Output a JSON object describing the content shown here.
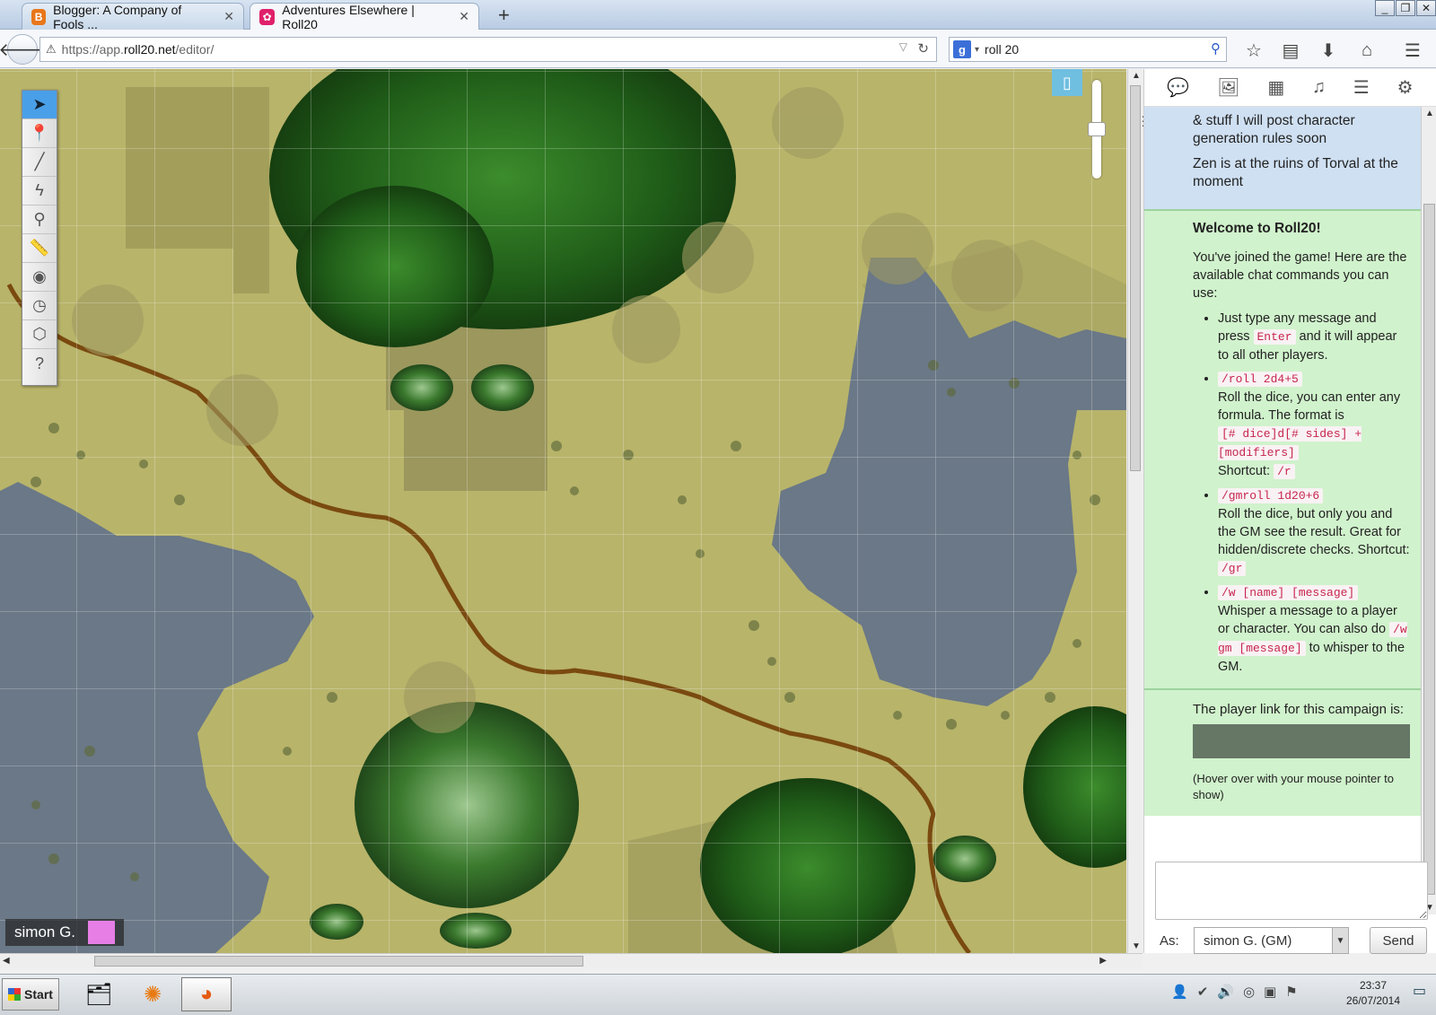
{
  "browser": {
    "tabs": [
      {
        "title": "Blogger: A Company of Fools ...",
        "icon": "blogger-icon",
        "active": false,
        "color": "#e8761a"
      },
      {
        "title": "Adventures Elsewhere | Roll20",
        "icon": "roll20-icon",
        "active": true,
        "color": "#e0206a"
      }
    ],
    "url_prefix": "https://app.",
    "url_domain": "roll20.net",
    "url_path": "/editor/",
    "search_query": "roll 20"
  },
  "map": {
    "tools": [
      "select-icon",
      "pin-icon",
      "brush-icon",
      "lightning-icon",
      "zoom-icon",
      "ruler-icon",
      "eye-icon",
      "clock-icon",
      "dice-icon",
      "help-icon"
    ],
    "player_name": "simon G.",
    "player_color": "#e67ee6",
    "zoom_level": 0.5
  },
  "chat": {
    "prev_line_1": "& stuff I will post character",
    "prev_line_2": "generation rules soon",
    "prev_msg_2": "Zen is at the ruins of Torval at the moment",
    "welcome_title": "Welcome to Roll20!",
    "welcome_intro": "You've joined the game! Here are the available chat commands you can use:",
    "cmd1_text_a": "Just type any message and press ",
    "cmd1_code": "Enter",
    "cmd1_text_b": " and it will appear to all other players.",
    "cmd2_code": "/roll 2d4+5",
    "cmd2_text": "Roll the dice, you can enter any formula. The format is",
    "cmd2_format": "[# dice]d[# sides] + [modifiers]",
    "cmd2_shortcut_label": "Shortcut: ",
    "cmd2_shortcut": "/r",
    "cmd3_code": "/gmroll 1d20+6",
    "cmd3_text": "Roll the dice, but only you and the GM see the result. Great for hidden/discrete checks. Shortcut: ",
    "cmd3_shortcut": "/gr",
    "cmd4_code": "/w [name] [message]",
    "cmd4_text_a": "Whisper a message to a player or character. You can also do ",
    "cmd4_code_b": "/w gm [message]",
    "cmd4_text_b": " to whisper to the GM.",
    "link_label": "The player link for this campaign is:",
    "link_hint": "(Hover over with your mouse pointer to show)",
    "as_label": "As:",
    "as_value": "simon G. (GM)",
    "send_label": "Send"
  },
  "taskbar": {
    "start_label": "Start",
    "time": "23:37",
    "date": "26/07/2014"
  }
}
